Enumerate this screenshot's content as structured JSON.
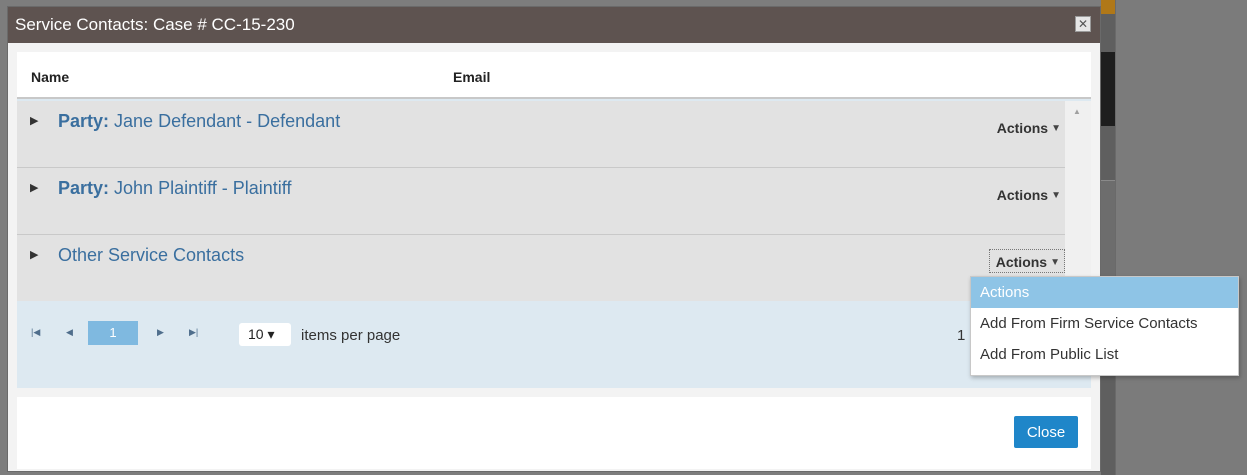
{
  "modal": {
    "title": "Service Contacts: Case # CC-15-230",
    "close_glyph": "✕"
  },
  "grid": {
    "columns": {
      "name": "Name",
      "email": "Email"
    },
    "rows": [
      {
        "prefix": "Party:",
        "label": " Jane Defendant - Defendant",
        "actions": "Actions"
      },
      {
        "prefix": "Party:",
        "label": " John Plaintiff - Plaintiff",
        "actions": "Actions"
      },
      {
        "prefix": "",
        "label": "Other Service Contacts",
        "actions": "Actions"
      }
    ]
  },
  "pager": {
    "first": "⏮",
    "prev": "◀",
    "current_page": "1",
    "next": "▶",
    "last": "⏭",
    "per_page_value": "10 ▾",
    "per_page_label": "items per page",
    "info": "1"
  },
  "dropdown": {
    "items": [
      "Actions",
      "Add From Firm Service Contacts",
      "Add From Public List"
    ],
    "selected": "Actions"
  },
  "footer": {
    "close_label": "Close"
  },
  "colors": {
    "titlebar": "#5e5350",
    "link": "#3a6f9f",
    "primary_button": "#1f86c9",
    "selected_item": "#8ec4e6"
  }
}
